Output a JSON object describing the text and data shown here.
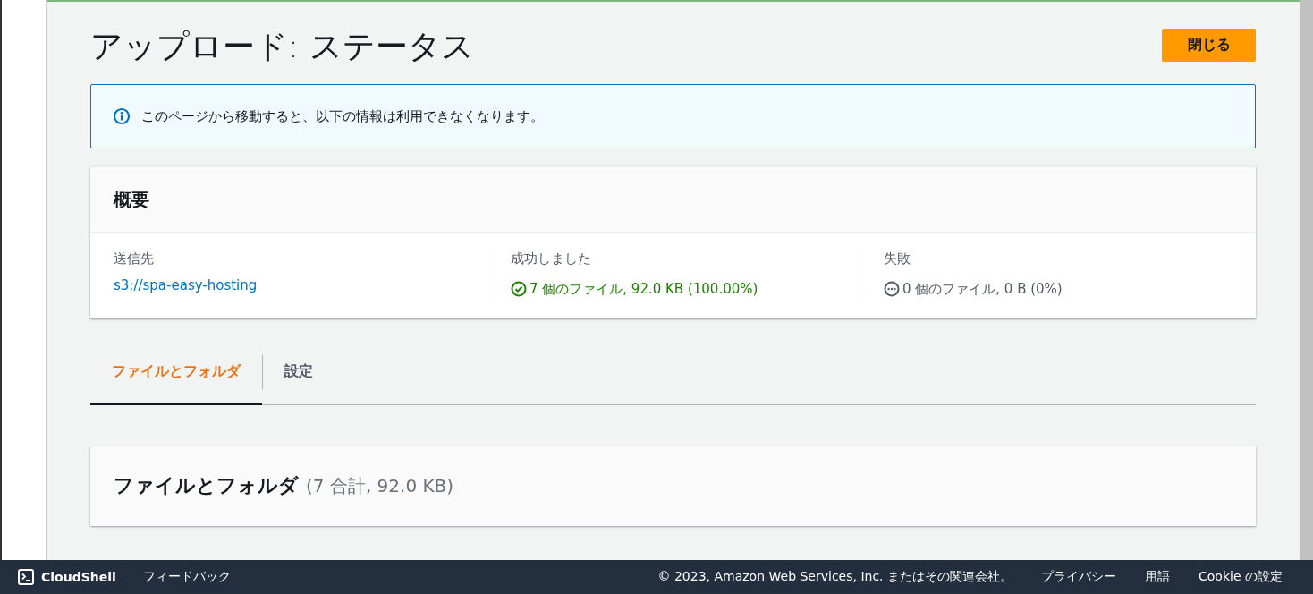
{
  "page": {
    "title": "アップロード: ステータス",
    "close_button": "閉じる"
  },
  "alert": {
    "message": "このページから移動すると、以下の情報は利用できなくなります。"
  },
  "summary": {
    "title": "概要",
    "columns": [
      {
        "kind": "link",
        "label": "送信先",
        "value": "s3://spa-easy-hosting"
      },
      {
        "kind": "success",
        "label": "成功しました",
        "value": "7 個のファイル, 92.0 KB (100.00%)"
      },
      {
        "kind": "pending",
        "label": "失敗",
        "value": "0 個のファイル, 0 B (0%)"
      }
    ]
  },
  "tabs": [
    {
      "label": "ファイルとフォルダ",
      "selected": true
    },
    {
      "label": "設定",
      "selected": false
    }
  ],
  "files": {
    "title": "ファイルとフォルダ",
    "count": "(7 合計, 92.0 KB)"
  },
  "footer": {
    "cloudshell": "CloudShell",
    "feedback": "フィードバック",
    "copyright": "© 2023, Amazon Web Services, Inc. またはその関連会社。",
    "links": [
      "プライバシー",
      "用語",
      "Cookie の設定"
    ]
  }
}
